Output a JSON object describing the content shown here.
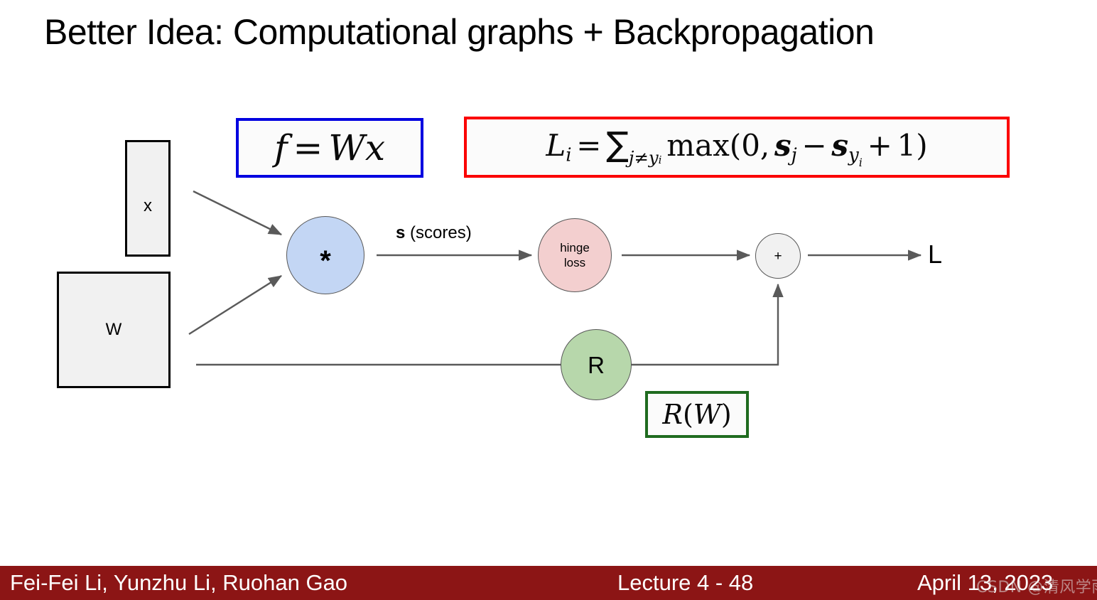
{
  "slide": {
    "title": "Better Idea: Computational graphs + Backpropagation"
  },
  "diagram": {
    "inputs": [
      {
        "name": "x",
        "label": "x",
        "shape": "tall-rectangle",
        "fill": "#f1f1f1"
      },
      {
        "name": "W",
        "label": "W",
        "shape": "square",
        "fill": "#f1f1f1"
      }
    ],
    "nodes": [
      {
        "name": "multiply",
        "label": "*",
        "fill": "#c3d6f4"
      },
      {
        "name": "hinge-loss",
        "label_line1": "hinge",
        "label_line2": "loss",
        "fill": "#f3cfcf"
      },
      {
        "name": "add",
        "label": "+",
        "fill": "#f1f1f1"
      },
      {
        "name": "regularization",
        "label": "R",
        "fill": "#b7d7ab"
      }
    ],
    "edge_label_bold": "s",
    "edge_label_rest": " (scores)",
    "output_label": "L"
  },
  "formulas": {
    "score": {
      "box_color": "#0000e0",
      "text": "f = Wx",
      "parts": {
        "f": "f",
        "eq": "=",
        "W": "W",
        "x": "x"
      }
    },
    "loss": {
      "box_color": "#fb0000",
      "text": "L_i = ∑_{j≠y_i} max(0, s_j − s_{y_i} + 1)",
      "parts": {
        "L": "L",
        "Li_sub": "i",
        "eq": "=",
        "sum": "∑",
        "sum_sub_j": "j",
        "sum_sub_ne": "≠",
        "sum_sub_y": "y",
        "sum_sub_yi": "i",
        "max": "max",
        "open": "(",
        "zero": "0",
        "comma": ",",
        "s1": "s",
        "s1_sub": "j",
        "minus": "−",
        "s2": "s",
        "s2_sub": "y",
        "s2_subsub": "i",
        "plus": "+",
        "one": "1",
        "close": ")"
      }
    },
    "regularization": {
      "box_color": "#1f6b1f",
      "text": "R(W)",
      "parts": {
        "R": "R",
        "open": "(",
        "W": "W",
        "close": ")"
      }
    }
  },
  "footer": {
    "background": "#8c1515",
    "authors": "Fei-Fei Li, Yunzhu Li, Ruohan Gao",
    "lecture": "Lecture 4 - 48",
    "date": "April 13, 2023"
  },
  "watermark": {
    "text": "CSDN @清风学雨"
  }
}
